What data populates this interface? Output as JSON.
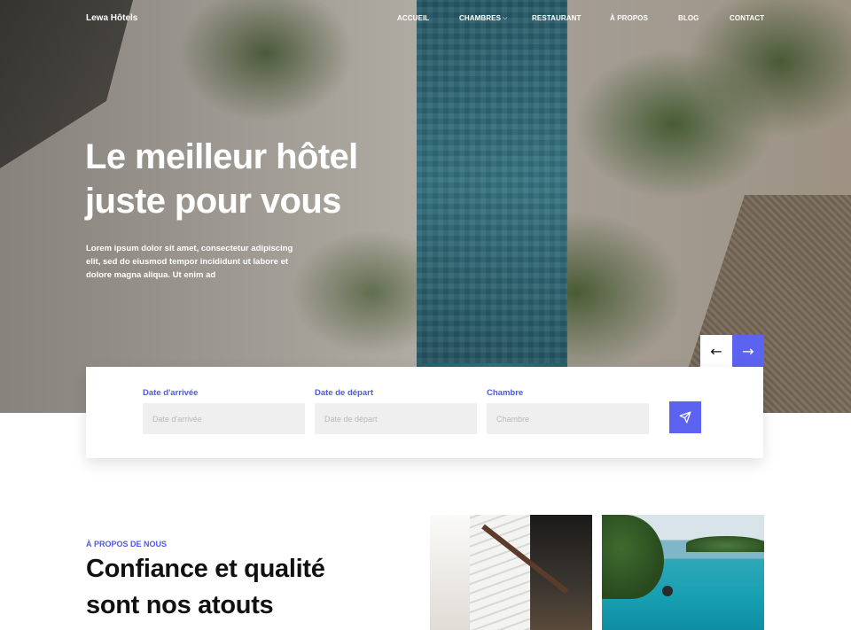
{
  "nav": {
    "brand": "Lewa Hôtels",
    "items": [
      {
        "label": "ACCUEIL"
      },
      {
        "label": "CHAMBRES",
        "has_dropdown": true
      },
      {
        "label": "RESTAURANT"
      },
      {
        "label": "À PROPOS"
      },
      {
        "label": "BLOG"
      },
      {
        "label": "CONTACT"
      }
    ]
  },
  "hero": {
    "title_line1": "Le meilleur hôtel",
    "title_line2": "juste pour vous",
    "subtitle": "Lorem ipsum dolor sit amet, consectetur adipiscing elit, sed do eiusmod tempor incididunt ut labore et dolore magna aliqua. Ut enim ad",
    "prev_icon": "arrow-left-icon",
    "next_icon": "arrow-right-icon"
  },
  "booking": {
    "arrival": {
      "label": "Date d'arrivée",
      "placeholder": "Date d'arrivée"
    },
    "departure": {
      "label": "Date de départ",
      "placeholder": "Date de départ"
    },
    "room": {
      "label": "Chambre",
      "placeholder": "Chambre"
    },
    "submit_icon": "send-icon"
  },
  "about": {
    "tag": "À PROPOS DE NOUS",
    "title_line1": "Confiance et qualité",
    "title_line2": "sont nos atouts"
  },
  "colors": {
    "accent": "#5b63f0",
    "accent_text": "#4f58e6",
    "input_bg": "#efefef"
  }
}
